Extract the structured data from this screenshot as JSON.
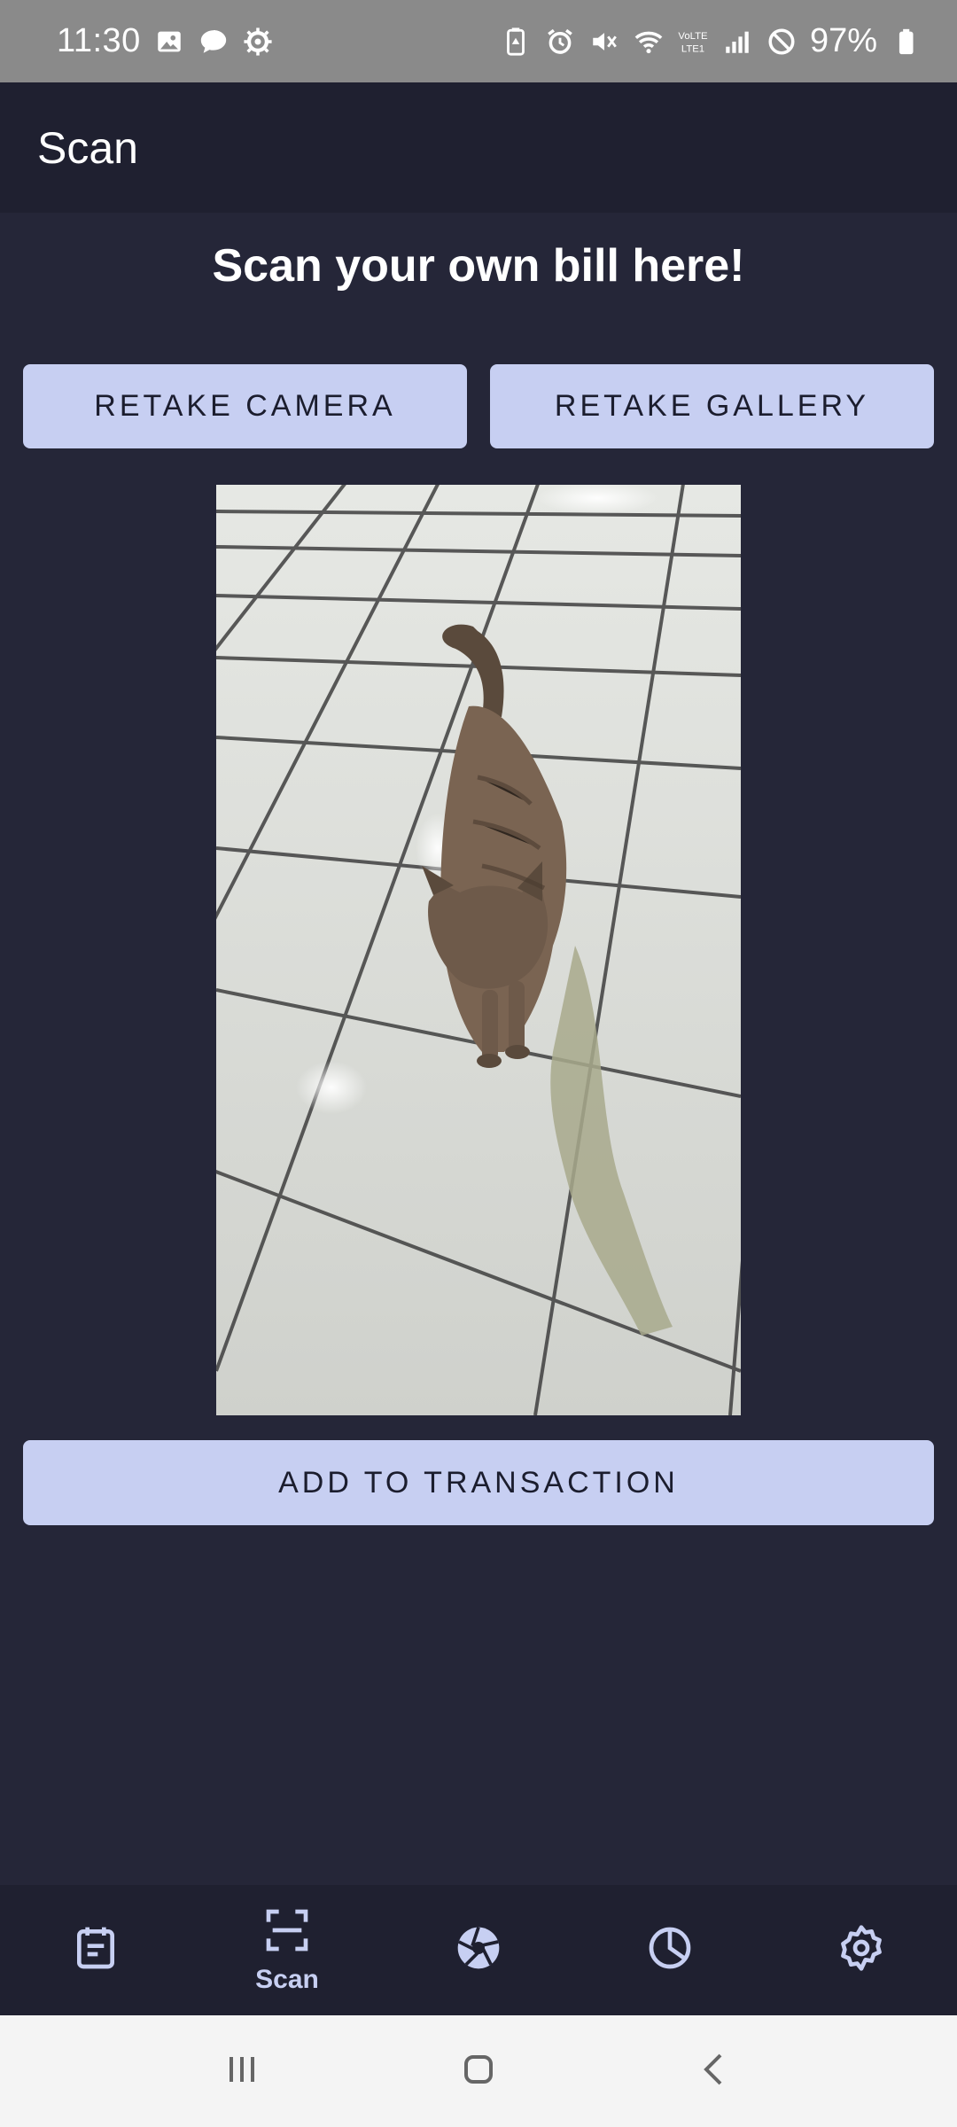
{
  "status_bar": {
    "time": "11:30",
    "battery": "97%",
    "icons_left": [
      "image-icon",
      "chat-bubble-icon",
      "settings-gear-icon"
    ],
    "icons_right": [
      "battery-saver-icon",
      "alarm-icon",
      "mute-icon",
      "wifi-icon",
      "volte-icon",
      "signal-icon",
      "do-not-disturb-icon",
      "battery-icon"
    ]
  },
  "app_bar": {
    "title": "Scan"
  },
  "main": {
    "heading": "Scan your own bill here!",
    "retake_camera_label": "RETAKE CAMERA",
    "retake_gallery_label": "RETAKE GALLERY",
    "add_to_transaction_label": "ADD TO TRANSACTION"
  },
  "bottom_nav": {
    "items": [
      {
        "icon": "notes-icon",
        "label": ""
      },
      {
        "icon": "scan-icon",
        "label": "Scan"
      },
      {
        "icon": "camera-shutter-icon",
        "label": ""
      },
      {
        "icon": "pie-chart-icon",
        "label": ""
      },
      {
        "icon": "settings-icon",
        "label": ""
      }
    ]
  },
  "colors": {
    "background": "#252638",
    "app_bar": "#1f2030",
    "button": "#c7cff2",
    "button_text": "#1b1d2e",
    "status_bar": "#8a8a8a"
  }
}
